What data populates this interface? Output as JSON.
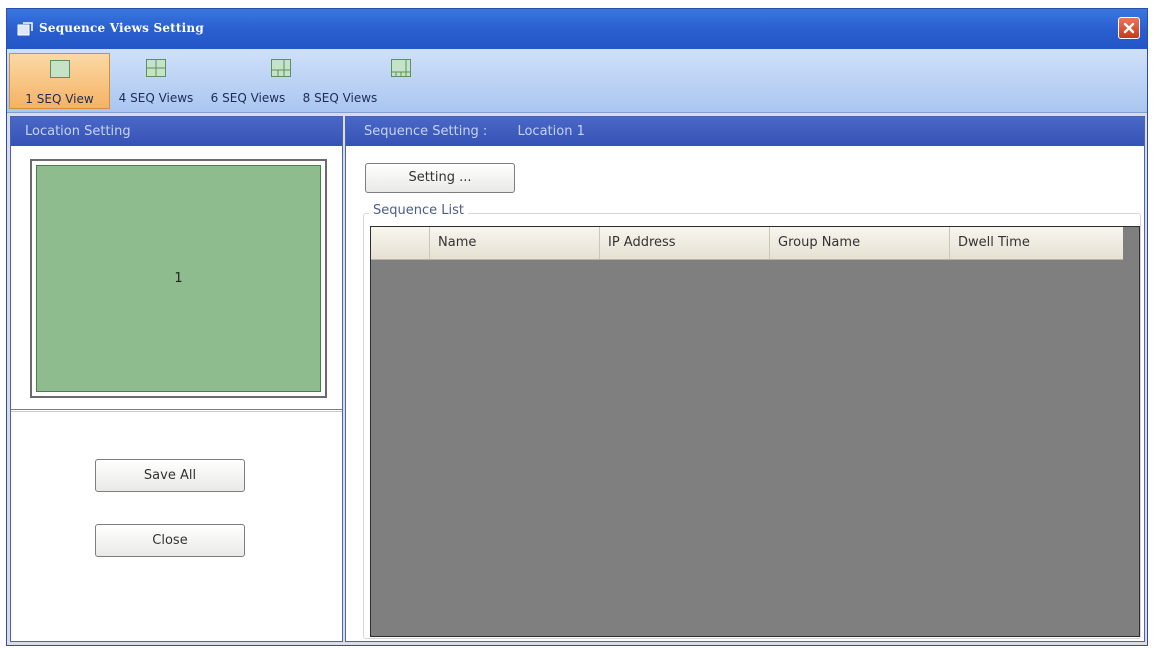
{
  "window": {
    "title": "Sequence Views Setting"
  },
  "toolbar": {
    "buttons": [
      {
        "label": "1 SEQ View",
        "icon": "single-view-icon",
        "active": true
      },
      {
        "label": "4 SEQ Views",
        "icon": "quad-view-icon",
        "active": false
      },
      {
        "label": "6 SEQ Views",
        "icon": "six-view-icon",
        "active": false
      },
      {
        "label": "8 SEQ Views",
        "icon": "eight-view-icon",
        "active": false
      }
    ]
  },
  "location_panel": {
    "header": "Location Setting",
    "preview_cell_label": "1",
    "save_all_label": "Save All",
    "close_label": "Close"
  },
  "sequence_panel": {
    "header_label": "Sequence Setting :",
    "header_location": "Location 1",
    "setting_button": "Setting ...",
    "list_legend": "Sequence List",
    "columns": [
      "Name",
      "IP Address",
      "Group Name",
      "Dwell Time"
    ]
  },
  "colors": {
    "title_bar": "#2a5fd0",
    "panel_header": "#3552b6",
    "active_tab": "#f5b264",
    "preview_cell": "#8fbc8f",
    "table_body": "#7f7f7f"
  }
}
